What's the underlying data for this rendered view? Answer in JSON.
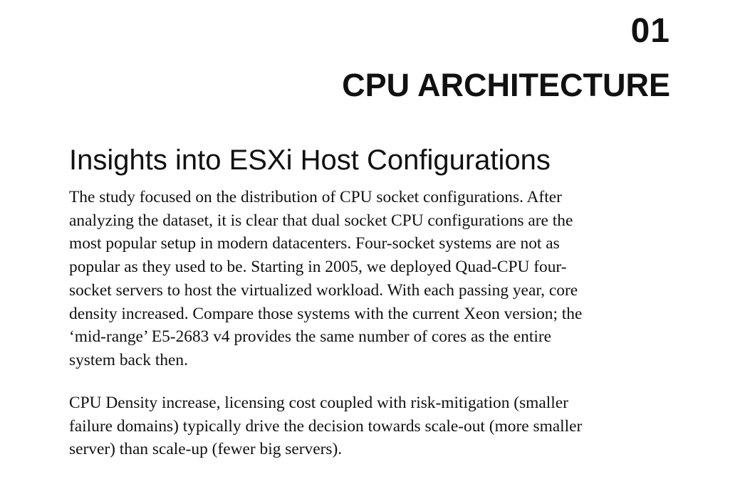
{
  "chapter": {
    "number": "01",
    "title": "CPU ARCHITECTURE"
  },
  "section": {
    "heading": "Insights into ESXi Host Configurations"
  },
  "paragraphs": [
    {
      "lines": [
        "The study focused on the distribution of CPU socket configurations. After",
        "analyzing the dataset, it is clear that dual socket CPU configurations are the",
        "most popular setup in modern datacenters. Four-socket systems are not as",
        "popular as they used to be. Starting in 2005, we deployed Quad-CPU four-",
        "socket servers to host the virtualized workload. With each passing year, core",
        "density increased. Compare those systems with the current Xeon version; the",
        "‘mid-range’ E5-2683 v4 provides the same number of cores as the entire",
        "system back then."
      ]
    },
    {
      "lines": [
        "CPU Density increase, licensing cost coupled with risk-mitigation (smaller",
        "failure domains) typically drive the decision towards scale-out (more smaller",
        "server) than scale-up (fewer big servers)."
      ]
    }
  ]
}
